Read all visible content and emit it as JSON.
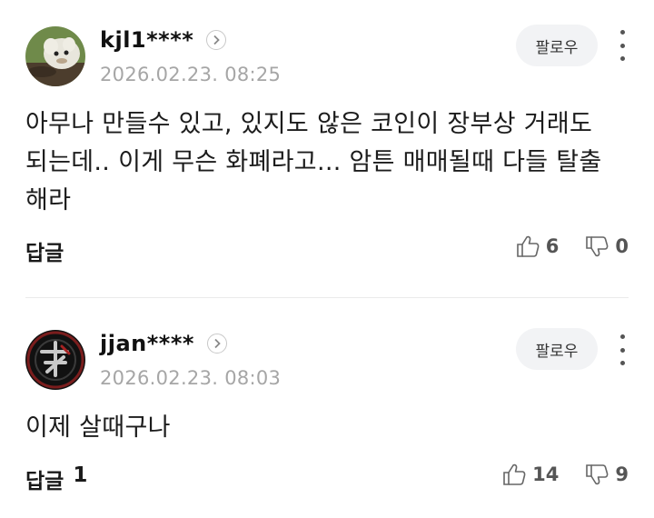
{
  "comments": [
    {
      "nickname": "kjl1****",
      "timestamp": "2026.02.23. 08:25",
      "follow_label": "팔로우",
      "text": "아무나 만들수 있고, 있지도 않은 코인이 장부상 거래도 되는데.. 이게 무슨 화폐라고... 암튼 매매될때 다들 탈출해라",
      "reply_label": "답글",
      "reply_count": "",
      "likes": "6",
      "dislikes": "0",
      "avatar_icon": "cartoon-character-avatar"
    },
    {
      "nickname": "jjan****",
      "timestamp": "2026.02.23. 08:03",
      "follow_label": "팔로우",
      "text": "이제 살때구나",
      "reply_label": "답글",
      "reply_count": "1",
      "likes": "14",
      "dislikes": "9",
      "avatar_icon": "calligraphy-emblem-avatar"
    }
  ],
  "icons": {
    "chevron": "chevron-right-icon",
    "more": "more-vertical-icon",
    "like": "thumbs-up-icon",
    "dislike": "thumbs-down-icon"
  }
}
